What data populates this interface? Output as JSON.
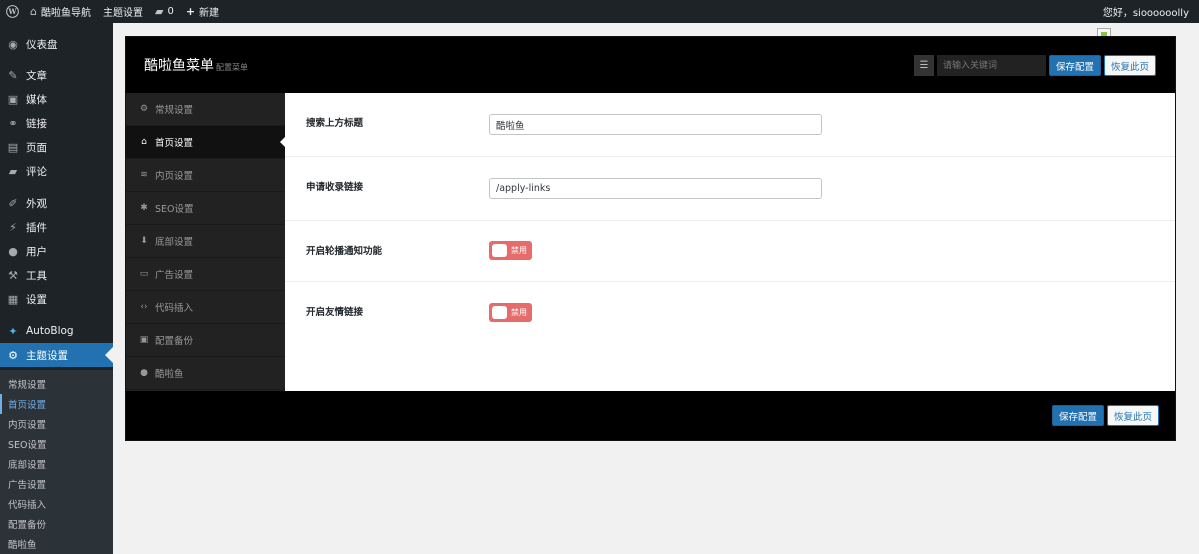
{
  "admin_bar": {
    "site_name": "酷啦鱼导航",
    "theme_settings": "主题设置",
    "comments_count": "0",
    "new_label": "新建",
    "greeting": "您好，sioooooolly"
  },
  "admin_menu": {
    "items": [
      {
        "label": "仪表盘",
        "icon": "dashboard-icon",
        "glyph": "◉"
      },
      {
        "label": "文章",
        "icon": "pin-icon",
        "glyph": "✎"
      },
      {
        "label": "媒体",
        "icon": "media-icon",
        "glyph": "▣"
      },
      {
        "label": "链接",
        "icon": "link-icon",
        "glyph": "⚭"
      },
      {
        "label": "页面",
        "icon": "page-icon",
        "glyph": "▤"
      },
      {
        "label": "评论",
        "icon": "comment-icon",
        "glyph": "▰"
      },
      {
        "label": "外观",
        "icon": "appearance-icon",
        "glyph": "✐"
      },
      {
        "label": "插件",
        "icon": "plugin-icon",
        "glyph": "⚡"
      },
      {
        "label": "用户",
        "icon": "user-icon",
        "glyph": "●"
      },
      {
        "label": "工具",
        "icon": "wrench-icon",
        "glyph": "⚒"
      },
      {
        "label": "设置",
        "icon": "settings-icon",
        "glyph": "▦"
      },
      {
        "label": "AutoBlog",
        "icon": "autoblog-icon",
        "glyph": "✦"
      },
      {
        "label": "主题设置",
        "icon": "gear-icon",
        "glyph": "⚙"
      }
    ],
    "submenu": [
      "常规设置",
      "首页设置",
      "内页设置",
      "SEO设置",
      "底部设置",
      "广告设置",
      "代码插入",
      "配置备份",
      "酷啦鱼"
    ]
  },
  "panel": {
    "title": "酷啦鱼菜单",
    "subtitle": "配置菜单",
    "search_placeholder": "请输入关键词",
    "save_label": "保存配置",
    "reset_label": "恢复此页",
    "nav": [
      {
        "label": "常规设置",
        "icon": "gear-icon",
        "glyph": "⚙"
      },
      {
        "label": "首页设置",
        "icon": "home-icon",
        "glyph": "⌂"
      },
      {
        "label": "内页设置",
        "icon": "layers-icon",
        "glyph": "≋"
      },
      {
        "label": "SEO设置",
        "icon": "seo-icon",
        "glyph": "✱"
      },
      {
        "label": "底部设置",
        "icon": "arrow-down-circle-icon",
        "glyph": "⬇"
      },
      {
        "label": "广告设置",
        "icon": "ad-icon",
        "glyph": "▭"
      },
      {
        "label": "代码插入",
        "icon": "code-icon",
        "glyph": "‹›"
      },
      {
        "label": "配置备份",
        "icon": "backup-icon",
        "glyph": "▣"
      },
      {
        "label": "酷啦鱼",
        "icon": "user-icon",
        "glyph": "●"
      }
    ],
    "fields": [
      {
        "label": "搜索上方标题",
        "type": "text",
        "value": "酷啦鱼"
      },
      {
        "label": "申请收录链接",
        "type": "text",
        "value": "/apply-links"
      },
      {
        "label": "开启轮播通知功能",
        "type": "switch",
        "state": "禁用"
      },
      {
        "label": "开启友情链接",
        "type": "switch",
        "state": "禁用"
      }
    ]
  }
}
